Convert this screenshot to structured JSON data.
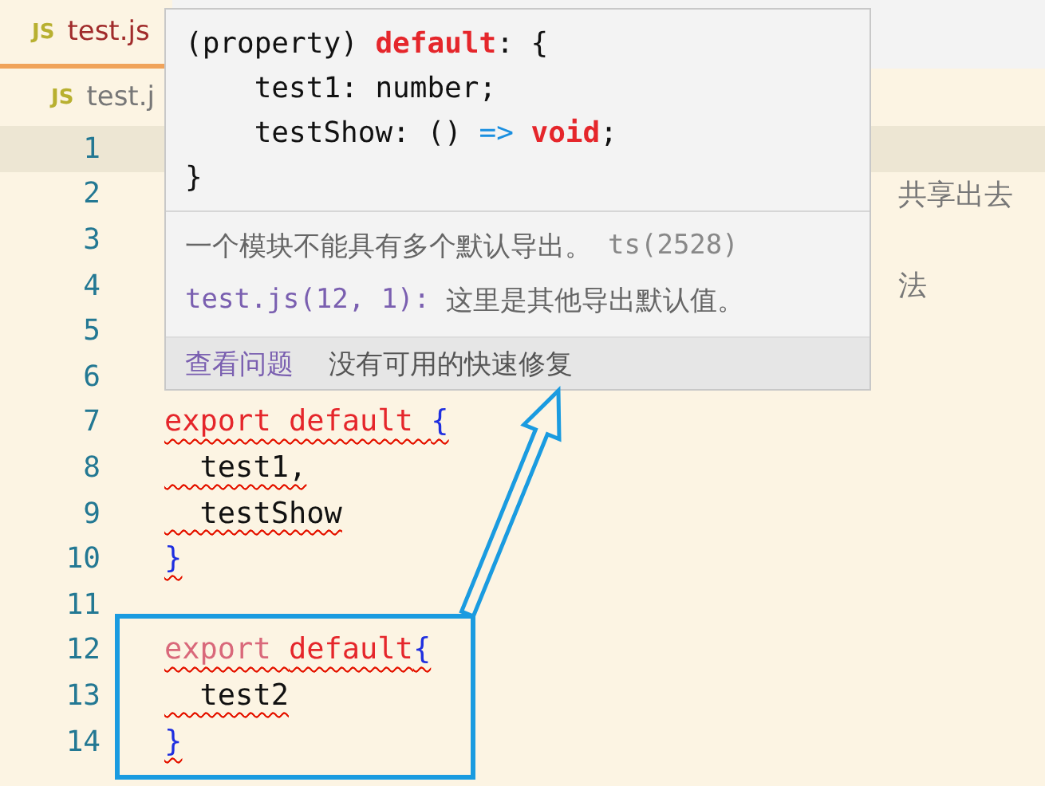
{
  "tabs": [
    {
      "label": "test.js",
      "icon": "JS",
      "selected": true
    }
  ],
  "breadcrumb": {
    "icon": "JS",
    "label": "test.j"
  },
  "lines": [
    {
      "number": "1",
      "current": true
    },
    {
      "number": "2",
      "current": false,
      "tail": "共享出去"
    },
    {
      "number": "3",
      "current": false
    },
    {
      "number": "4",
      "current": false,
      "tail": "法"
    },
    {
      "number": "5",
      "current": false
    },
    {
      "number": "6",
      "current": false
    },
    {
      "number": "7",
      "current": false,
      "error": true,
      "tokens": [
        {
          "kind": "keyword",
          "text": "export default "
        },
        {
          "kind": "brace",
          "text": "{"
        }
      ]
    },
    {
      "number": "8",
      "current": false,
      "error": true,
      "tokens": [
        {
          "kind": "plain",
          "text": "  test1,"
        }
      ]
    },
    {
      "number": "9",
      "current": false,
      "error": true,
      "tokens": [
        {
          "kind": "plain",
          "text": "  testShow"
        }
      ]
    },
    {
      "number": "10",
      "current": false,
      "error": true,
      "tokens": [
        {
          "kind": "brace",
          "text": "}"
        }
      ]
    },
    {
      "number": "11",
      "current": false
    },
    {
      "number": "12",
      "current": false,
      "error": true,
      "tokens": [
        {
          "kind": "faded",
          "text": "export "
        },
        {
          "kind": "keyword",
          "text": "default"
        },
        {
          "kind": "brace",
          "text": "{"
        }
      ]
    },
    {
      "number": "13",
      "current": false,
      "error": true,
      "tokens": [
        {
          "kind": "plain",
          "text": "  test2"
        }
      ]
    },
    {
      "number": "14",
      "current": false,
      "error": true,
      "tokens": [
        {
          "kind": "brace",
          "text": "}"
        }
      ]
    }
  ],
  "hover": {
    "signature": [
      [
        {
          "kind": "plain",
          "text": "(property) "
        },
        {
          "kind": "keyword",
          "text": "default"
        },
        {
          "kind": "plain",
          "text": ": {"
        }
      ],
      [
        {
          "kind": "plain",
          "text": "    test1: number;"
        }
      ],
      [
        {
          "kind": "plain",
          "text": "    testShow: () "
        },
        {
          "kind": "operator",
          "text": "=>"
        },
        {
          "kind": "keyword",
          "text": " void"
        },
        {
          "kind": "plain",
          "text": ";"
        }
      ],
      [
        {
          "kind": "plain",
          "text": "}"
        }
      ]
    ],
    "message": "一个模块不能具有多个默认导出。",
    "code": "ts(2528)",
    "related": {
      "location": "test.js(12, 1):",
      "text": "这里是其他导出默认值。"
    },
    "actions": [
      {
        "kind": "link",
        "label": "查看问题"
      },
      {
        "kind": "text",
        "label": "没有可用的快速修复"
      }
    ]
  }
}
